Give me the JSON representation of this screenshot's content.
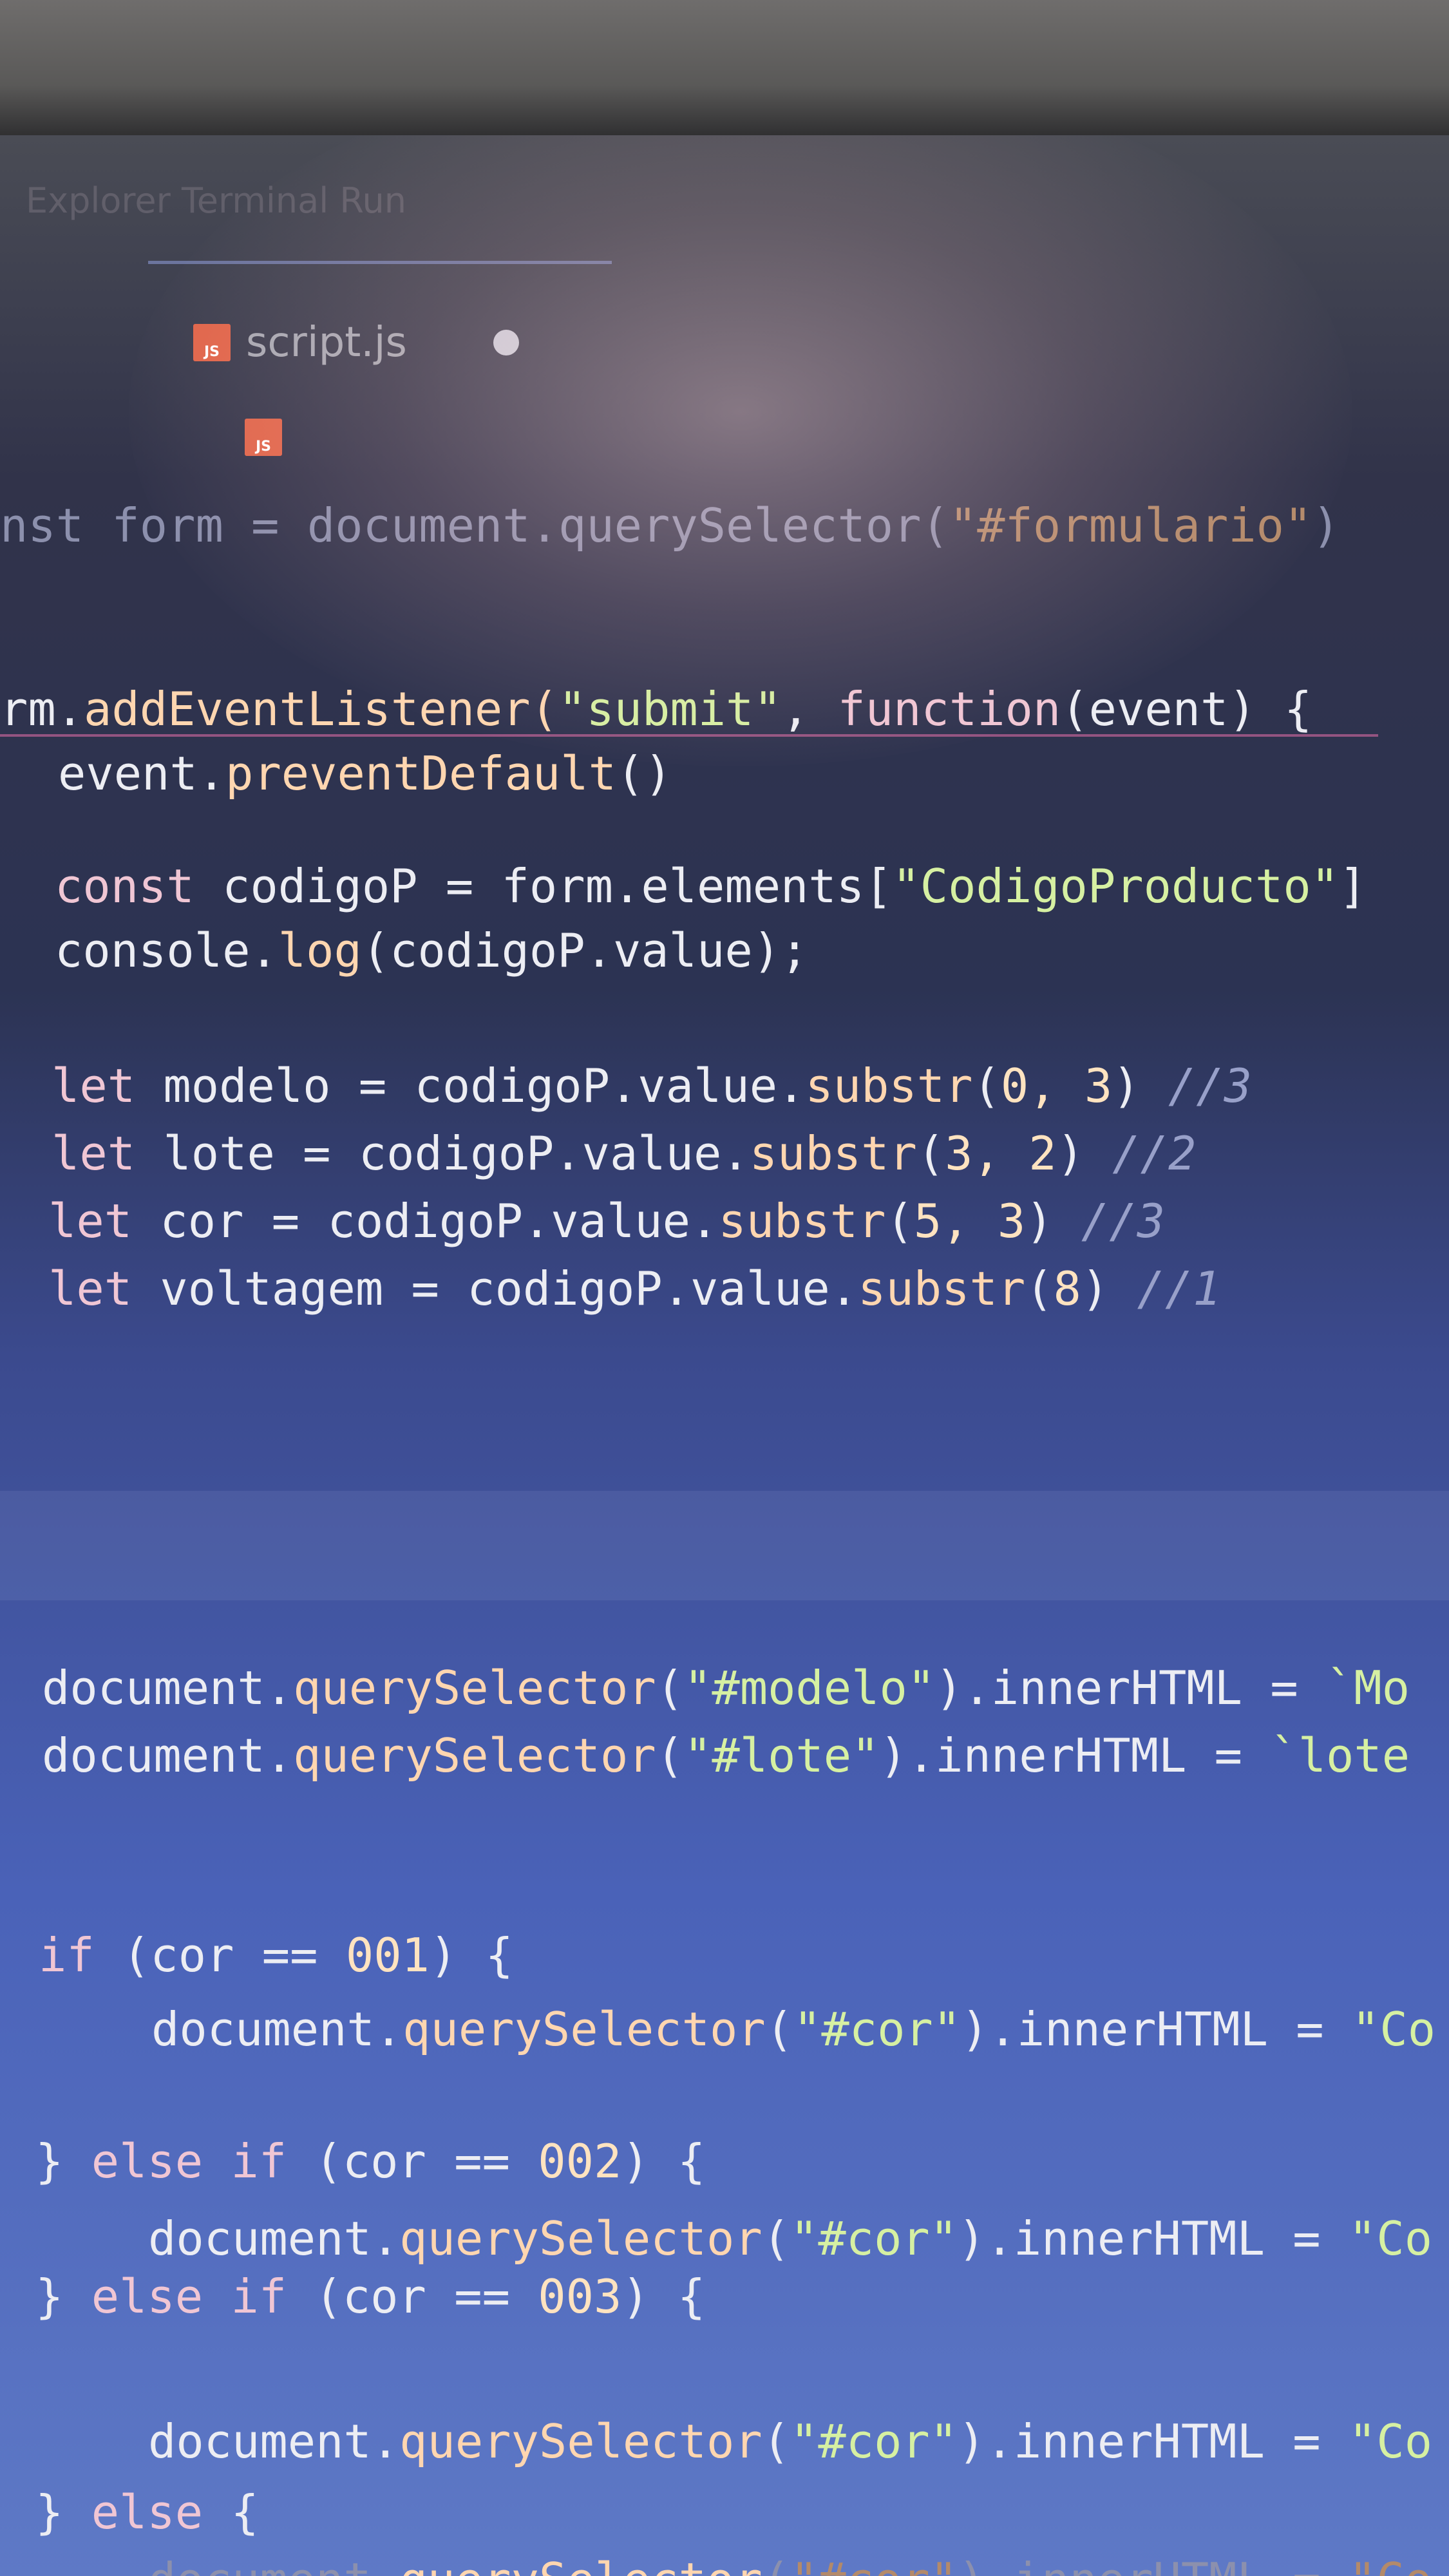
{
  "editor": {
    "faded_tabs_text": "Explorer  Terminal  Run",
    "tabs": [
      {
        "label": "script.js",
        "icon_text": "JS",
        "modified": true
      },
      {
        "label": "",
        "icon_text": "JS"
      }
    ]
  },
  "colors": {
    "keyword": "#f0c6d4",
    "string": "#d6f0a2",
    "comment": "#98a0c9",
    "function": "#ffd6b0",
    "js_icon": "#e0654a"
  },
  "code_lines": [
    {
      "text": "nst form = document.querySelector(\"#formulario\")"
    },
    {
      "text": "rm.addEventListener(\"submit\", function(event) {"
    },
    {
      "text": "event.preventDefault()"
    },
    {
      "text": "const codigoP = form.elements[\"CodigoProducto\"]"
    },
    {
      "text": "console.log(codigoP.value);"
    },
    {
      "text": "let modelo = codigoP.value.substr(0, 3) //3"
    },
    {
      "text": "let lote = codigoP.value.substr(3, 2) //2"
    },
    {
      "text": "let cor = codigoP.value.substr(5, 3) //3"
    },
    {
      "text": "let voltagem = codigoP.value.substr(8) //1"
    },
    {
      "text": "document.querySelector(\"#modelo\").innerHTML = `Mo"
    },
    {
      "text": "document.querySelector(\"#lote\").innerHTML = `lote"
    },
    {
      "text": "if (cor == 001) {"
    },
    {
      "text": "document.querySelector(\"#cor\").innerHTML = \"Co"
    },
    {
      "text": "} else if (cor == 002) {"
    },
    {
      "text": "document.querySelector(\"#cor\").innerHTML = \"Co"
    },
    {
      "text": "} else if (cor == 003) {"
    },
    {
      "text": "document.querySelector(\"#cor\").innerHTML = \"Co"
    },
    {
      "text": "} else {"
    },
    {
      "text": "document.querySelector(\"#cor\").innerHTML = \"Co"
    }
  ]
}
